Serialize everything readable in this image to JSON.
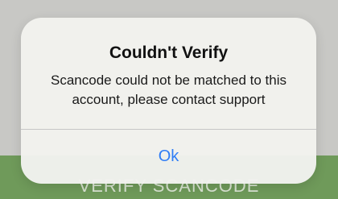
{
  "background": {
    "verify_button_label": "VERIFY SCANCODE"
  },
  "alert": {
    "title": "Couldn't Verify",
    "message": "Scancode could not be matched to this account, please contact support",
    "ok_label": "Ok"
  },
  "colors": {
    "alert_background": "#f2f2ee",
    "link_blue": "#2f7df6",
    "verify_bar_green": "#6f9a5a"
  }
}
